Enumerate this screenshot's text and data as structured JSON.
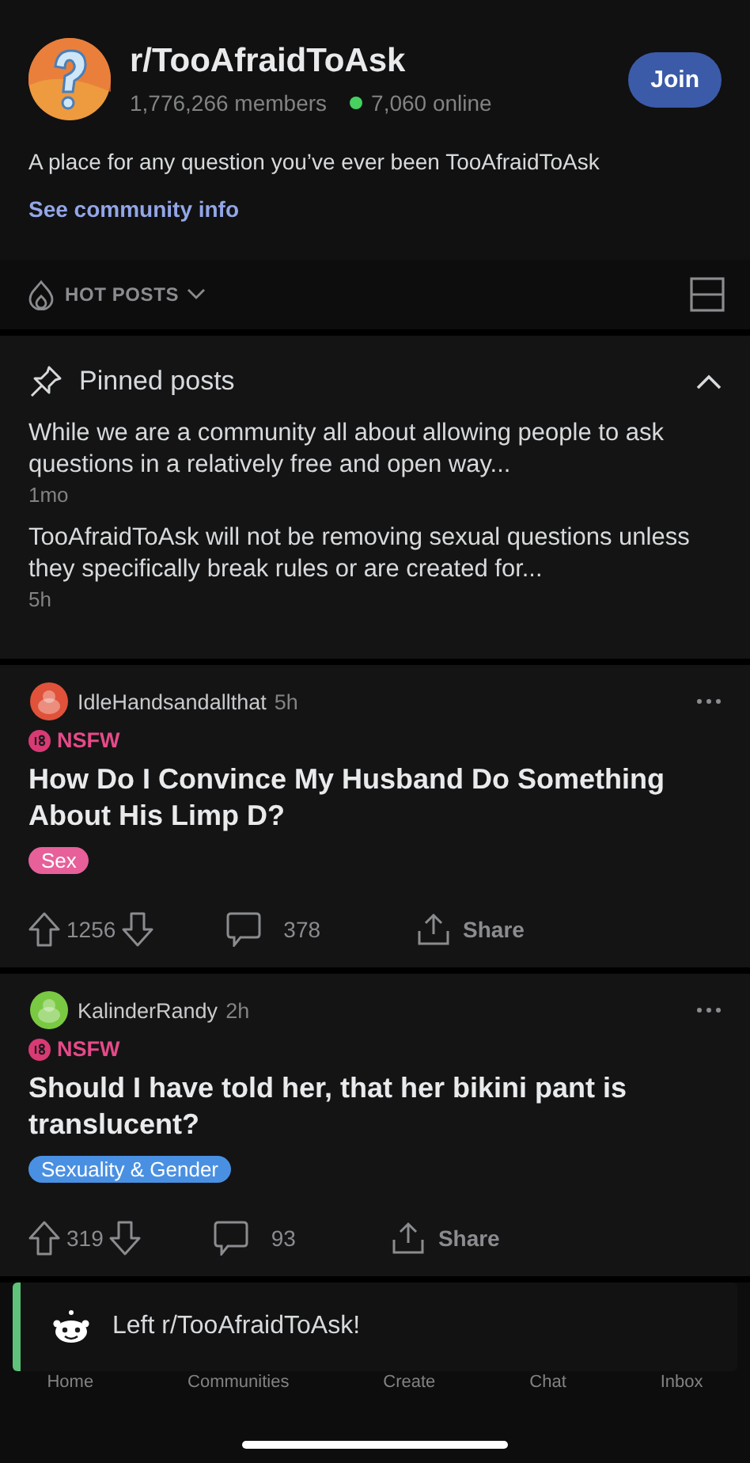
{
  "community": {
    "name": "r/TooAfraidToAsk",
    "members": "1,776,266 members",
    "online": "7,060 online",
    "join_label": "Join",
    "description": "A place for any question you’ve ever been TooAfraidToAsk",
    "info_link": "See community info"
  },
  "sort_bar": {
    "label": "HOT POSTS"
  },
  "pinned": {
    "title": "Pinned posts",
    "expanded": true,
    "items": [
      {
        "text": "While we are a community all about allowing people to ask questions in a relatively free and open way...",
        "age": "1mo"
      },
      {
        "text": "TooAfraidToAsk will not be removing sexual questions unless they specifically break rules or are created for...",
        "age": "5h"
      }
    ]
  },
  "posts": [
    {
      "author": "IdleHandsandallthat",
      "age": "5h",
      "avatar": {
        "color": "#e0523a"
      },
      "nsfw": true,
      "nsfw_label": "NSFW",
      "title": "How Do I Convince My Husband Do Something About His Limp D?",
      "flair": {
        "label": "Sex",
        "color": "#e7609a"
      },
      "score": "1256",
      "comments": "378",
      "share_label": "Share"
    },
    {
      "author": "KalinderRandy",
      "age": "2h",
      "avatar": {
        "color": "#7ac943"
      },
      "nsfw": true,
      "nsfw_label": "NSFW",
      "title": "Should I have told her, that her bikini pant is translucent?",
      "flair": {
        "label": "Sexuality & Gender",
        "color": "#4a90e2"
      },
      "score": "319",
      "comments": "93",
      "share_label": "Share"
    }
  ],
  "toast": {
    "message": "Left r/TooAfraidToAsk!",
    "color": "#5ec27a"
  },
  "tab_bar": [
    "Home",
    "Communities",
    "Create",
    "Chat",
    "Inbox"
  ]
}
